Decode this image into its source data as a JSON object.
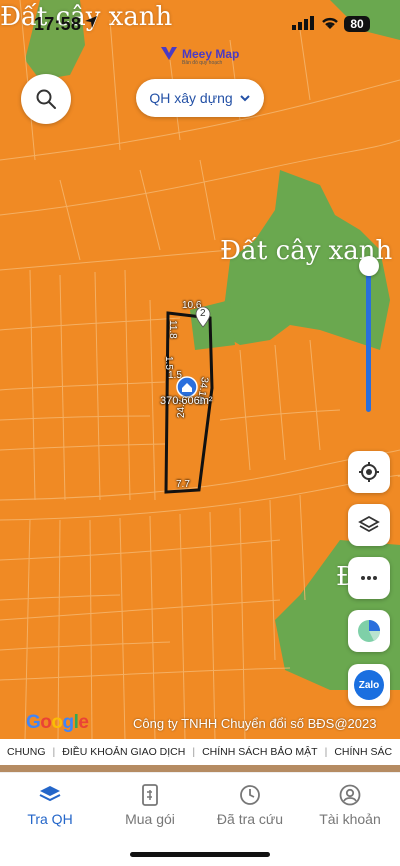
{
  "status_bar": {
    "time": "17:58",
    "battery": "80"
  },
  "brand": {
    "name": "Meey Map",
    "tagline": "Bản đồ quy hoạch"
  },
  "layer_select": {
    "value": "QH xây dựng"
  },
  "map": {
    "zone_labels": [
      "Đất cây xanh",
      "Đất cây xanh",
      "Đ"
    ],
    "parcel": {
      "area": "370.606m²",
      "dimensions": [
        "10.6",
        "11.8",
        "1.5",
        "1.5",
        "24.7",
        "34.1m",
        "7.7"
      ],
      "marker_number": "2"
    }
  },
  "map_controls": {
    "buttons": [
      "locate",
      "layers",
      "more",
      "chart",
      "zalo"
    ],
    "zalo_label": "Zalo"
  },
  "attribution": {
    "provider": "Google",
    "copyright": "Công ty TNHH Chuyển đổi số BĐS@2023"
  },
  "policy_bar": {
    "items": [
      "CHUNG",
      "ĐIỀU KHOẢN GIAO DỊCH",
      "CHÍNH SÁCH BẢO MẬT",
      "CHÍNH SÁC"
    ]
  },
  "tabs": [
    {
      "label": "Tra QH",
      "icon": "layers-icon",
      "active": true
    },
    {
      "label": "Mua gói",
      "icon": "receipt-icon",
      "active": false
    },
    {
      "label": "Đã tra cứu",
      "icon": "clock-icon",
      "active": false
    },
    {
      "label": "Tài khoản",
      "icon": "user-icon",
      "active": false
    }
  ],
  "colors": {
    "zone_orange": "#f08a24",
    "green_zone": "#6aa84f",
    "accent_blue": "#2466c9"
  }
}
